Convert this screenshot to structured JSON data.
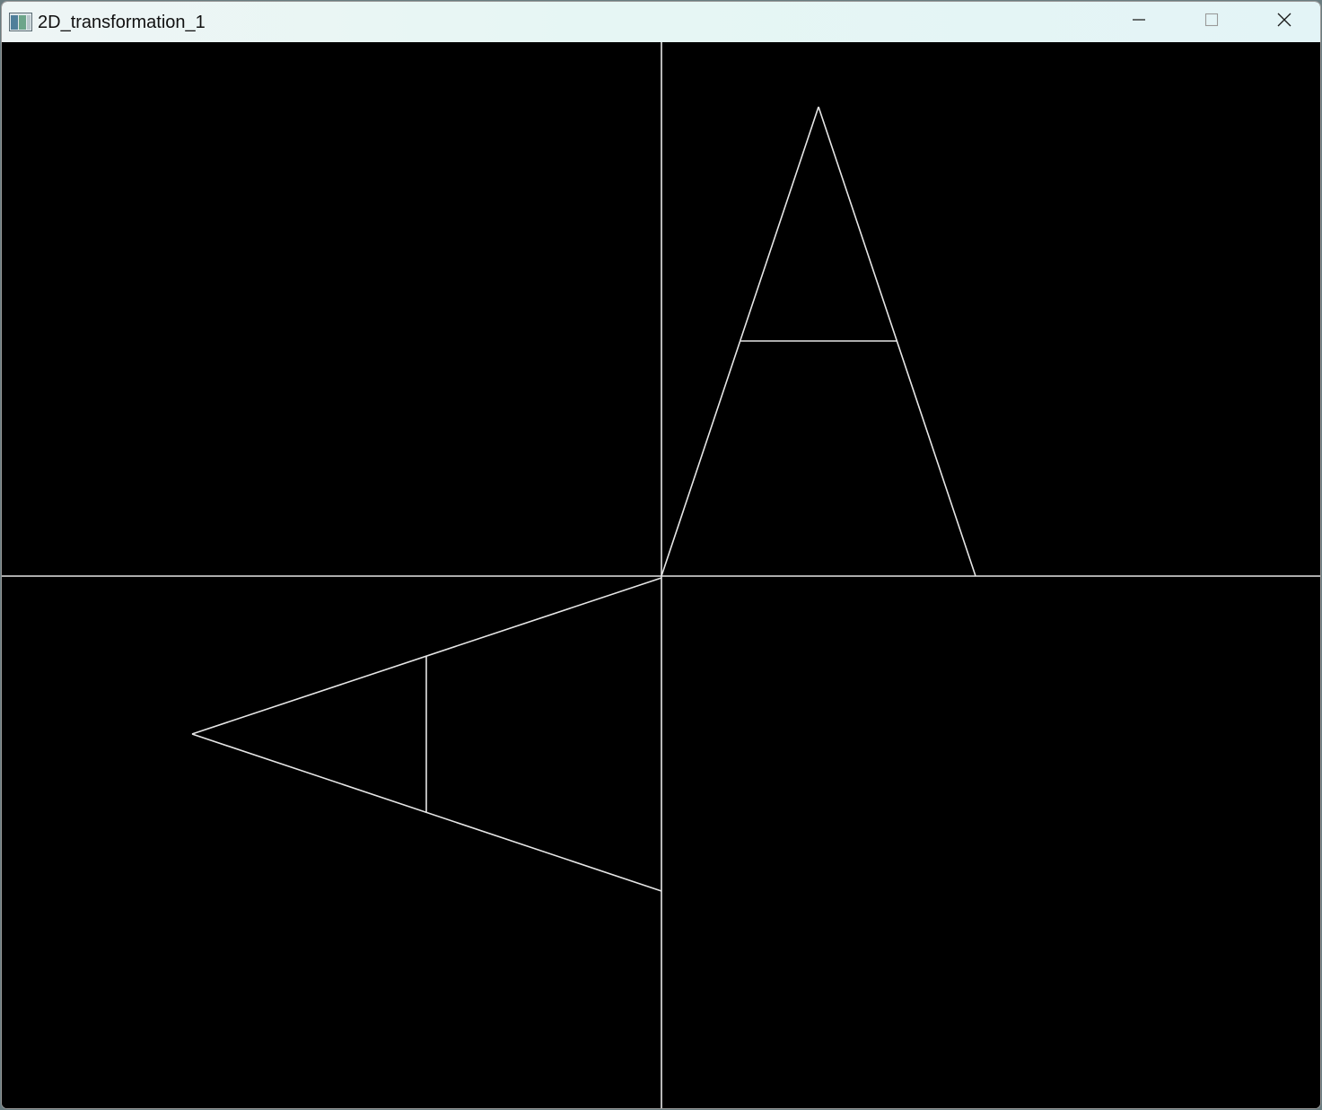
{
  "window": {
    "title": "2D_transformation_1",
    "icon": "app-window-icon",
    "controls": {
      "minimize": "minimize-icon",
      "maximize": "maximize-icon",
      "close": "close-icon"
    }
  },
  "colors": {
    "background": "#000000",
    "line": "#e6e6e6",
    "titlebar": "#e8f5f4"
  }
}
